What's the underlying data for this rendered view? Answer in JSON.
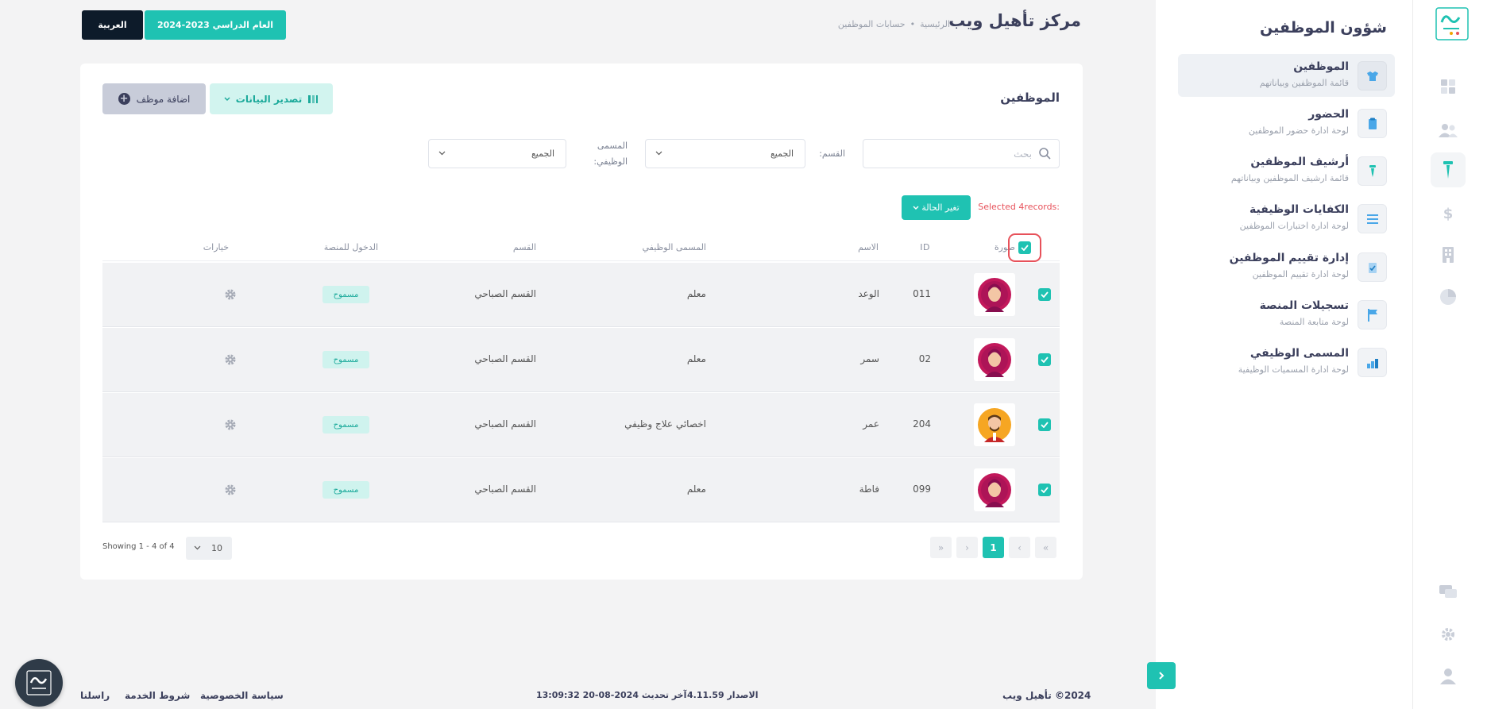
{
  "header": {
    "brand": "مركز تأهيل ويب",
    "breadcrumbs": [
      "الرئيسية",
      "حسابات الموظفين"
    ],
    "year_button": "العام الدراسي 2023-2024",
    "lang_button": "العربية"
  },
  "sidebar": {
    "title": "شؤون الموظفين",
    "items": [
      {
        "title": "الموظفين",
        "subtitle": "قائمة الموظفين وبياناتهم",
        "icon": "shirt-icon",
        "active": true
      },
      {
        "title": "الحضور",
        "subtitle": "لوحة ادارة حضور الموظفين",
        "icon": "clipboard-icon"
      },
      {
        "title": "أرشيف الموظفين",
        "subtitle": "قائمة ارشيف الموظفين وبياناتهم",
        "icon": "tie-icon"
      },
      {
        "title": "الكفايات الوظيفية",
        "subtitle": "لوحة ادارة اختبارات الموظفين",
        "icon": "list-icon"
      },
      {
        "title": "إدارة تقييم الموظفين",
        "subtitle": "لوحة ادارة تقييم الموظفين",
        "icon": "clipboard-check-icon"
      },
      {
        "title": "تسجيلات المنصة",
        "subtitle": "لوحة متابعة المنصة",
        "icon": "flag-icon"
      },
      {
        "title": "المسمى الوظيفي",
        "subtitle": "لوحة ادارة المسميات الوظيفية",
        "icon": "bar-chart-icon"
      }
    ]
  },
  "card": {
    "title": "الموظفين",
    "add_button": "اضافة موظف",
    "export_button": "تصدير البيانات",
    "search_placeholder": "بحث",
    "dept_label": "القسم:",
    "dept_value": "الجميع",
    "job_label_line1": "المسمى",
    "job_label_line2": "الوظيفي:",
    "job_value": "الجميع",
    "selected_text": "Selected 4records:",
    "status_button": "تغير الحالة"
  },
  "table": {
    "headers": {
      "photo": "صورة",
      "id": "ID",
      "name": "الاسم",
      "job": "المسمى الوظيفي",
      "dept": "القسم",
      "access": "الدخول للمنصة",
      "options": "خيارات"
    },
    "rows": [
      {
        "id": "011",
        "name": "الوعد",
        "job": "معلم",
        "dept": "القسم الصباحي",
        "access": "مسموح",
        "avatar": "female"
      },
      {
        "id": "02",
        "name": "سمر",
        "job": "معلم",
        "dept": "القسم الصباحي",
        "access": "مسموح",
        "avatar": "female"
      },
      {
        "id": "204",
        "name": "عمر",
        "job": "اخصائي علاج وظيفي",
        "dept": "القسم الصباحي",
        "access": "مسموح",
        "avatar": "male"
      },
      {
        "id": "099",
        "name": "فاطة",
        "job": "معلم",
        "dept": "القسم الصباحي",
        "access": "مسموح",
        "avatar": "female"
      }
    ]
  },
  "pagination": {
    "current_page": "1",
    "first": "«",
    "prev": "‹",
    "next": "›",
    "last": "»",
    "per_page": "10",
    "showing": "Showing 1 - 4 of 4"
  },
  "footer": {
    "copyright": "2024© تأهيل ويب",
    "version": "الاصدار 4.11.59",
    "updated": "آخر تحديث 2024-08-20 13:09:32",
    "links": [
      "سياسة الخصوصية",
      "شروط الخدمة",
      "راسلنا"
    ]
  },
  "colors": {
    "accent": "#1fc2b2",
    "dark": "#0d1b2a",
    "danger": "#e7515a",
    "text": "#3b3f5c"
  }
}
